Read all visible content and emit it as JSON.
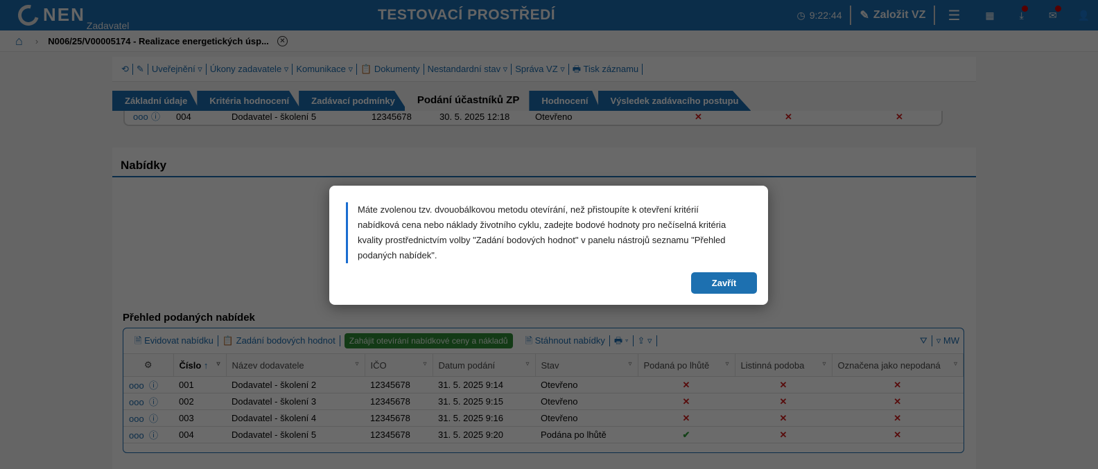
{
  "header": {
    "logo": "NEN",
    "logo_sub": "Zadavatel",
    "environment": "TESTOVACÍ PROSTŘEDÍ",
    "time": "9:22:44",
    "create_label": "Založit VZ"
  },
  "breadcrumb": {
    "title": "N006/25/V00005174 - Realizace energetických úsp..."
  },
  "toolbar": {
    "items": [
      "Uveřejnění ▿",
      "Úkony zadavatele ▿",
      "Komunikace ▿",
      "Dokumenty",
      "Nestandardní stav ▿",
      "Správa VZ ▿",
      "Tisk záznamu"
    ]
  },
  "tabs": [
    "Základní údaje",
    "Kritéria hodnocení",
    "Zadávací podmínky",
    "Podání účastníků ZP",
    "Hodnocení",
    "Výsledek zadávacího postupu"
  ],
  "upper_row": {
    "num": "004",
    "name": "Dodavatel - školení 5",
    "ico": "12345678",
    "date": "30. 5. 2025 12:18",
    "status": "Otevřeno"
  },
  "section": {
    "title": "Nabídky",
    "subtitle": "Přehled podaných nabídek"
  },
  "grid": {
    "toolbar": {
      "register": "Evidovat nabídku",
      "points": "Zadání bodových hodnot",
      "open": "Zahájit otevírání nabídkové ceny a nákladů",
      "download": "Stáhnout nabídky",
      "user": "MW"
    },
    "columns": [
      "Číslo",
      "Název dodavatele",
      "IČO",
      "Datum podání",
      "Stav",
      "Podaná po lhůtě",
      "Listinná podoba",
      "Označena jako nepodaná"
    ],
    "rows": [
      {
        "num": "001",
        "name": "Dodavatel - školení 2",
        "ico": "12345678",
        "date": "31. 5. 2025 9:14",
        "status": "Otevřeno",
        "late": "✕",
        "paper": "✕",
        "unsub": "✕"
      },
      {
        "num": "002",
        "name": "Dodavatel - školení 3",
        "ico": "12345678",
        "date": "31. 5. 2025 9:15",
        "status": "Otevřeno",
        "late": "✕",
        "paper": "✕",
        "unsub": "✕"
      },
      {
        "num": "003",
        "name": "Dodavatel - školení 4",
        "ico": "12345678",
        "date": "31. 5. 2025 9:16",
        "status": "Otevřeno",
        "late": "✕",
        "paper": "✕",
        "unsub": "✕"
      },
      {
        "num": "004",
        "name": "Dodavatel - školení 5",
        "ico": "12345678",
        "date": "31. 5. 2025 9:20",
        "status": "Podána po lhůtě",
        "late": "✔",
        "paper": "✕",
        "unsub": "✕"
      }
    ]
  },
  "modal": {
    "message": "Máte zvolenou tzv. dvouobálkovou metodu otevírání, než přistoupíte k otevření kritérií nabídková cena nebo náklady životního cyklu, zadejte bodové hodnoty pro nečíselná kritéria kvality prostřednictvím volby \"Zadání bodových hodnot\" v panelu nástrojů seznamu \"Přehled podaných nabídek\".",
    "close_label": "Zavřít"
  }
}
